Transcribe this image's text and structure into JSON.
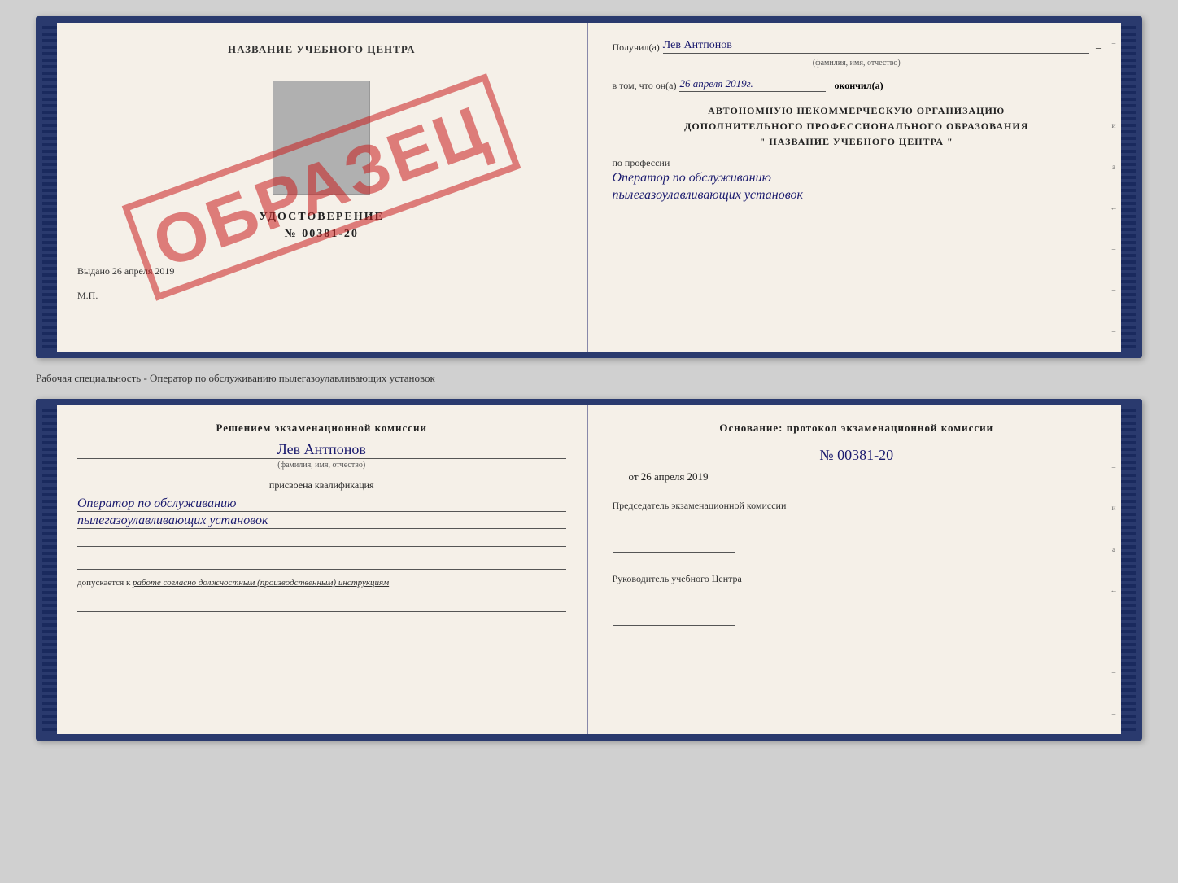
{
  "top_cert": {
    "left_page": {
      "title": "НАЗВАНИЕ УЧЕБНОГО ЦЕНТРА",
      "doc_type": "УДОСТОВЕРЕНИЕ",
      "doc_number": "№ 00381-20",
      "issued_label": "Выдано",
      "issued_date": "26 апреля 2019",
      "mp_label": "М.П.",
      "stamp_text": "ОБРАЗЕЦ"
    },
    "right_page": {
      "received_label": "Получил(а)",
      "received_name": "Лев Антпонов",
      "fio_sublabel": "(фамилия, имя, отчество)",
      "in_that_label": "в том, что он(а)",
      "date_value": "26 апреля 2019г.",
      "finished_label": "окончил(а)",
      "org_line1": "АВТОНОМНУЮ НЕКОММЕРЧЕСКУЮ ОРГАНИЗАЦИЮ",
      "org_line2": "ДОПОЛНИТЕЛЬНОГО ПРОФЕССИОНАЛЬНОГО ОБРАЗОВАНИЯ",
      "org_name": "\"  НАЗВАНИЕ УЧЕБНОГО ЦЕНТРА  \"",
      "profession_label": "по профессии",
      "profession_line1": "Оператор по обслуживанию",
      "profession_line2": "пылегазоулавливающих установок"
    }
  },
  "separator": {
    "text": "Рабочая специальность - Оператор по обслуживанию пылегазоулавливающих установок"
  },
  "bottom_cert": {
    "left_page": {
      "decision_header": "Решением экзаменационной комиссии",
      "person_name": "Лев Антпонов",
      "fio_sublabel": "(фамилия, имя, отчество)",
      "assigned_label": "присвоена квалификация",
      "qualification_line1": "Оператор по обслуживанию",
      "qualification_line2": "пылегазоулавливающих установок",
      "admission_prefix": "допускается к ",
      "admission_italic": "работе согласно должностным (производственным) инструкциям"
    },
    "right_page": {
      "basis_label": "Основание: протокол экзаменационной комиссии",
      "protocol_number": "№ 00381-20",
      "protocol_date_prefix": "от",
      "protocol_date": "26 апреля 2019",
      "chairman_label": "Председатель экзаменационной комиссии",
      "director_label": "Руководитель учебного Центра"
    }
  },
  "edge_marks": {
    "values": [
      "–",
      "–",
      "и",
      "а",
      "←",
      "–",
      "–",
      "–"
    ]
  }
}
